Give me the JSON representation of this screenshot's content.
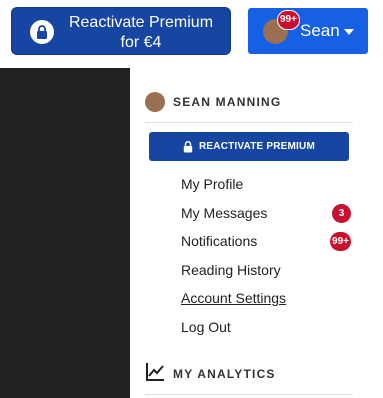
{
  "header": {
    "reactivate_button": {
      "line1": "Reactivate Premium",
      "line2": "for €4",
      "icon": "lock-icon"
    },
    "user_button": {
      "name": "Sean",
      "badge": "99+",
      "icon": "chevron-down-icon"
    }
  },
  "dropdown": {
    "user_full_name": "SEAN MANNING",
    "reactivate_label": "REACTIVATE PREMIUM",
    "items": [
      {
        "label": "My Profile",
        "count": ""
      },
      {
        "label": "My Messages",
        "count": "3"
      },
      {
        "label": "Notifications",
        "count": "99+"
      },
      {
        "label": "Reading History",
        "count": ""
      },
      {
        "label": "Account Settings",
        "count": ""
      },
      {
        "label": "Log Out",
        "count": ""
      }
    ],
    "analytics_label": "MY ANALYTICS"
  },
  "colors": {
    "primary_dark": "#1746a2",
    "primary_bright": "#1660e6",
    "badge_red": "#c8102e",
    "backdrop": "#222222"
  }
}
